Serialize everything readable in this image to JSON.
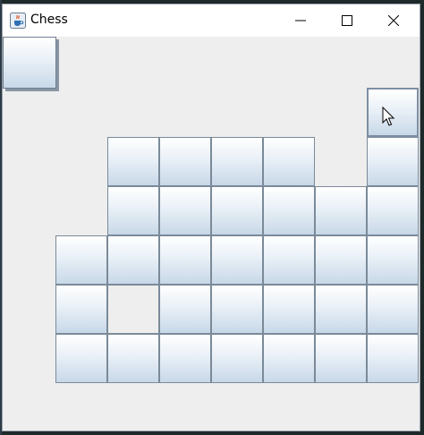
{
  "window": {
    "title": "Chess",
    "app_icon": "java-coffee-cup-icon",
    "controls": {
      "minimize": "minimize-icon",
      "maximize": "maximize-icon",
      "close": "close-icon"
    }
  },
  "colors": {
    "window_bg": "#eeeeee",
    "titlebar_bg": "#ffffff",
    "button_border": "#7a8a99",
    "button_gradient_top": "#ffffff",
    "button_gradient_bottom": "#c8d8e8"
  },
  "board": {
    "rows": [
      {
        "row": 0,
        "cols": [
          {
            "col": 0,
            "state": "raised"
          }
        ]
      },
      {
        "row": 1,
        "cols": [
          {
            "col": 7,
            "state": "focus"
          }
        ]
      },
      {
        "row": 2,
        "cols": [
          {
            "col": 2,
            "state": "button"
          },
          {
            "col": 3,
            "state": "button"
          },
          {
            "col": 4,
            "state": "button"
          },
          {
            "col": 5,
            "state": "button"
          },
          {
            "col": 7,
            "state": "button"
          }
        ]
      },
      {
        "row": 3,
        "cols": [
          {
            "col": 2,
            "state": "button"
          },
          {
            "col": 3,
            "state": "button"
          },
          {
            "col": 4,
            "state": "button"
          },
          {
            "col": 5,
            "state": "button"
          },
          {
            "col": 6,
            "state": "button"
          },
          {
            "col": 7,
            "state": "button"
          }
        ]
      },
      {
        "row": 4,
        "cols": [
          {
            "col": 1,
            "state": "button"
          },
          {
            "col": 2,
            "state": "button"
          },
          {
            "col": 3,
            "state": "button"
          },
          {
            "col": 4,
            "state": "button"
          },
          {
            "col": 5,
            "state": "button"
          },
          {
            "col": 6,
            "state": "button"
          },
          {
            "col": 7,
            "state": "button"
          }
        ]
      },
      {
        "row": 5,
        "cols": [
          {
            "col": 1,
            "state": "button"
          },
          {
            "col": 2,
            "state": "empty"
          },
          {
            "col": 3,
            "state": "button"
          },
          {
            "col": 4,
            "state": "button"
          },
          {
            "col": 5,
            "state": "button"
          },
          {
            "col": 6,
            "state": "button"
          },
          {
            "col": 7,
            "state": "button"
          }
        ]
      },
      {
        "row": 6,
        "cols": [
          {
            "col": 1,
            "state": "button"
          },
          {
            "col": 2,
            "state": "button"
          },
          {
            "col": 3,
            "state": "button"
          },
          {
            "col": 4,
            "state": "button"
          },
          {
            "col": 5,
            "state": "button"
          },
          {
            "col": 6,
            "state": "button"
          },
          {
            "col": 7,
            "state": "button"
          }
        ]
      }
    ]
  },
  "pointer": "mouse-cursor-icon"
}
